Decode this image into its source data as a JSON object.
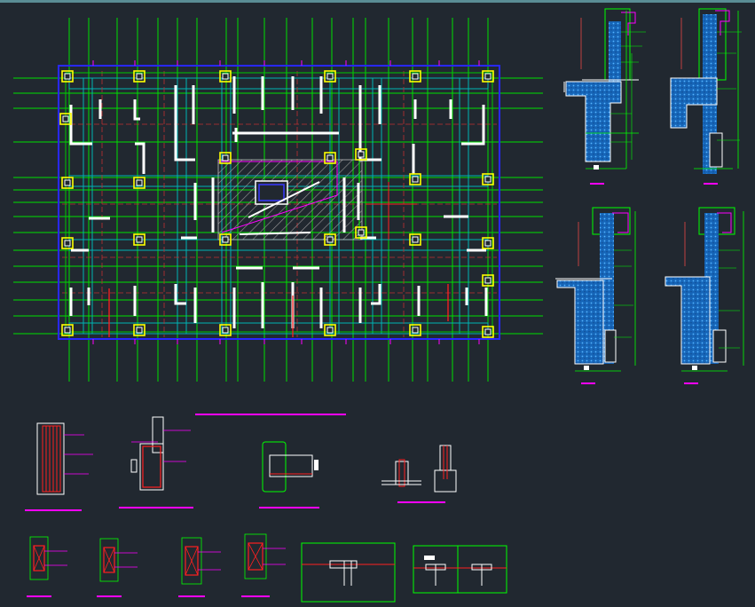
{
  "app": {
    "background": "#212830",
    "viewport_bar_color": "#5a8d95"
  },
  "colors": {
    "grid_green": "#00ff00",
    "beam_cyan": "#00c8c8",
    "axis_red": "#ff2020",
    "column_yellow": "#ffff00",
    "wall_white": "#ffffff",
    "dim_magenta": "#ff00ff",
    "boundary_blue": "#2020ff",
    "hatch_gray": "#909090",
    "hatch_blue": "#1e7fd8"
  },
  "drawing": {
    "plan": {
      "label": "structure-floor-plan"
    },
    "wall_sections": [
      {
        "label": "section-1"
      },
      {
        "label": "section-2"
      },
      {
        "label": "section-3"
      },
      {
        "label": "section-4"
      }
    ],
    "details": [
      {
        "label": "detail-1"
      },
      {
        "label": "detail-2"
      },
      {
        "label": "detail-3"
      },
      {
        "label": "detail-4"
      }
    ]
  }
}
